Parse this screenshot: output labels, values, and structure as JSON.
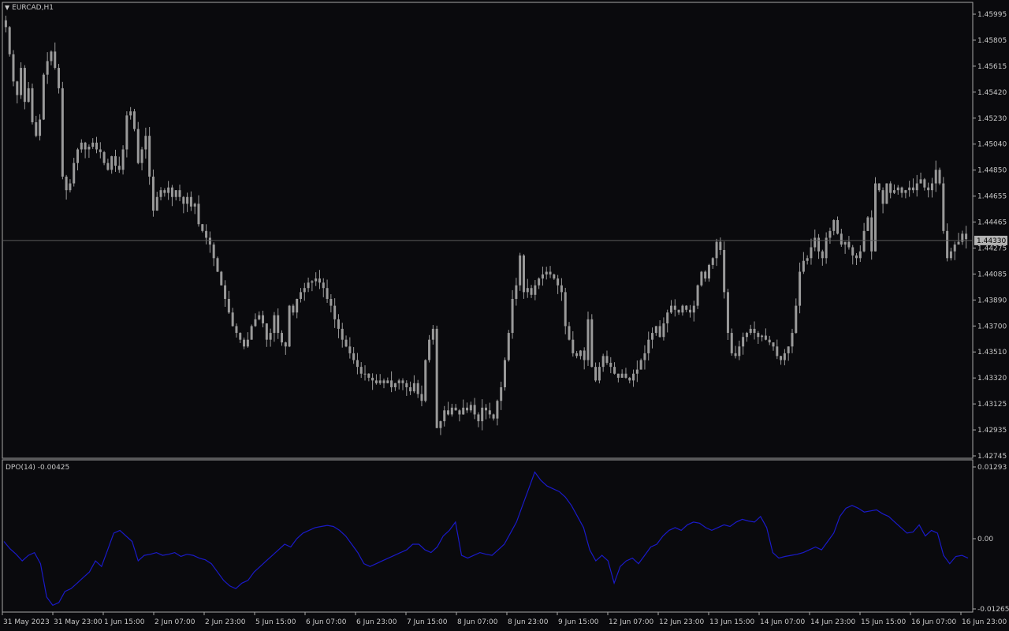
{
  "colors": {
    "background": "#0a0a0d",
    "frame": "#a8a8a8",
    "candle": "#9a9a9a",
    "current_price_line": "#5c5c5c",
    "price_tag_bg": "#b4b4b4",
    "price_tag_text": "#000000",
    "indicator_line": "#1a1ac8",
    "text": "#c8c8c8"
  },
  "header": {
    "symbol": "EURCAD,H1",
    "menu_icon": "triangle-down-icon"
  },
  "indicator": {
    "label": "DPO(14) -0.00425"
  },
  "current_price": "1.44330",
  "time_axis": [
    "31 May 2023",
    "31 May 23:00",
    "1 Jun 15:00",
    "2 Jun 07:00",
    "2 Jun 23:00",
    "5 Jun 15:00",
    "6 Jun 07:00",
    "6 Jun 23:00",
    "7 Jun 15:00",
    "8 Jun 07:00",
    "8 Jun 23:00",
    "9 Jun 15:00",
    "12 Jun 07:00",
    "12 Jun 23:00",
    "13 Jun 15:00",
    "14 Jun 07:00",
    "14 Jun 23:00",
    "15 Jun 15:00",
    "16 Jun 07:00",
    "16 Jun 23:00"
  ],
  "chart_data": [
    {
      "type": "candlestick",
      "title": "EURCAD,H1",
      "ylim": [
        1.42745,
        1.45995
      ],
      "y_ticks": [
        "1.45995",
        "1.45805",
        "1.45615",
        "1.45420",
        "1.45230",
        "1.45040",
        "1.44850",
        "1.44655",
        "1.44465",
        "1.44275",
        "1.44085",
        "1.43890",
        "1.43700",
        "1.43510",
        "1.43320",
        "1.43125",
        "1.42935",
        "1.42745"
      ],
      "close": [
        1.459,
        1.457,
        1.455,
        1.454,
        1.456,
        1.4535,
        1.4545,
        1.452,
        1.451,
        1.4522,
        1.4555,
        1.4565,
        1.4572,
        1.456,
        1.4545,
        1.448,
        1.447,
        1.4475,
        1.449,
        1.45,
        1.4505,
        1.45,
        1.4502,
        1.4505,
        1.45,
        1.4498,
        1.449,
        1.4485,
        1.4495,
        1.4488,
        1.4485,
        1.45,
        1.4525,
        1.4528,
        1.4515,
        1.449,
        1.45,
        1.451,
        1.448,
        1.4455,
        1.4465,
        1.447,
        1.4468,
        1.4472,
        1.4465,
        1.447,
        1.4465,
        1.446,
        1.4465,
        1.4458,
        1.446,
        1.4445,
        1.444,
        1.4435,
        1.443,
        1.442,
        1.441,
        1.44,
        1.439,
        1.438,
        1.437,
        1.4365,
        1.436,
        1.4355,
        1.436,
        1.437,
        1.4375,
        1.4378,
        1.4372,
        1.436,
        1.4365,
        1.4378,
        1.4365,
        1.4358,
        1.4355,
        1.4385,
        1.438,
        1.439,
        1.4395,
        1.4398,
        1.4402,
        1.4403,
        1.4405,
        1.4402,
        1.4398,
        1.439,
        1.4385,
        1.4375,
        1.4368,
        1.436,
        1.4355,
        1.435,
        1.4345,
        1.434,
        1.4335,
        1.4335,
        1.4332,
        1.433,
        1.4328,
        1.433,
        1.4328,
        1.433,
        1.4325,
        1.4328,
        1.433,
        1.4328,
        1.4325,
        1.4322,
        1.4328,
        1.432,
        1.4315,
        1.4345,
        1.436,
        1.4368,
        1.4295,
        1.43,
        1.4308,
        1.4305,
        1.431,
        1.4308,
        1.4305,
        1.431,
        1.4308,
        1.4312,
        1.4305,
        1.43,
        1.431,
        1.4308,
        1.4305,
        1.4302,
        1.4315,
        1.4325,
        1.4345,
        1.4365,
        1.439,
        1.44,
        1.4422,
        1.4395,
        1.4398,
        1.4393,
        1.44,
        1.4405,
        1.4408,
        1.441,
        1.4408,
        1.4405,
        1.44,
        1.4395,
        1.437,
        1.436,
        1.435,
        1.4348,
        1.4352,
        1.4345,
        1.4375,
        1.434,
        1.433,
        1.434,
        1.4348,
        1.4343,
        1.434,
        1.4335,
        1.4332,
        1.4335,
        1.4332,
        1.433,
        1.4335,
        1.4338,
        1.4345,
        1.435,
        1.436,
        1.4365,
        1.437,
        1.4362,
        1.4372,
        1.438,
        1.4385,
        1.4382,
        1.438,
        1.4385,
        1.4382,
        1.438,
        1.4385,
        1.44,
        1.441,
        1.4405,
        1.4415,
        1.442,
        1.4432,
        1.4426,
        1.4395,
        1.4365,
        1.435,
        1.4348,
        1.4355,
        1.4362,
        1.4365,
        1.4368,
        1.4365,
        1.4362,
        1.4363,
        1.436,
        1.4358,
        1.4355,
        1.4348,
        1.4345,
        1.435,
        1.4355,
        1.4365,
        1.4385,
        1.441,
        1.4418,
        1.442,
        1.4428,
        1.4435,
        1.4425,
        1.442,
        1.4435,
        1.444,
        1.4448,
        1.4438,
        1.443,
        1.4432,
        1.4428,
        1.4422,
        1.442,
        1.4425,
        1.444,
        1.445,
        1.4425,
        1.4475,
        1.447,
        1.446,
        1.4475,
        1.4468,
        1.447,
        1.4472,
        1.4468,
        1.447,
        1.4472,
        1.447,
        1.4475,
        1.4478,
        1.4472,
        1.447,
        1.4475,
        1.4485,
        1.4475,
        1.444,
        1.442,
        1.4425,
        1.443,
        1.4432,
        1.4438,
        1.4434
      ]
    },
    {
      "type": "line",
      "title": "DPO(14) -0.00425",
      "ylim": [
        -0.01265,
        0.01293
      ],
      "y_ticks": [
        "0.01293",
        "0.00",
        "-0.01265"
      ],
      "series": [
        {
          "values": [
            -0.0005,
            -0.0018,
            -0.0028,
            -0.004,
            -0.003,
            -0.0025,
            -0.0045,
            -0.0105,
            -0.012,
            -0.0115,
            -0.0095,
            -0.009,
            -0.008,
            -0.007,
            -0.006,
            -0.004,
            -0.005,
            -0.002,
            0.001,
            0.0015,
            0.0005,
            -0.0005,
            -0.004,
            -0.003,
            -0.0028,
            -0.0025,
            -0.003,
            -0.0028,
            -0.0025,
            -0.0032,
            -0.0028,
            -0.003,
            -0.0035,
            -0.0038,
            -0.0045,
            -0.006,
            -0.0075,
            -0.0085,
            -0.009,
            -0.008,
            -0.0075,
            -0.006,
            -0.005,
            -0.004,
            -0.003,
            -0.002,
            -0.001,
            -0.0015,
            0.0,
            0.001,
            0.0015,
            0.002,
            0.0022,
            0.0024,
            0.0022,
            0.0015,
            0.0005,
            -0.001,
            -0.0025,
            -0.0045,
            -0.005,
            -0.0045,
            -0.004,
            -0.0035,
            -0.003,
            -0.0025,
            -0.002,
            -0.001,
            -0.001,
            -0.002,
            -0.0025,
            -0.0015,
            0.0005,
            0.0015,
            0.003,
            -0.003,
            -0.0035,
            -0.003,
            -0.0025,
            -0.0028,
            -0.003,
            -0.002,
            -0.001,
            0.001,
            0.003,
            0.006,
            0.009,
            0.012,
            0.0105,
            0.0095,
            0.009,
            0.0085,
            0.0075,
            0.006,
            0.004,
            0.002,
            -0.002,
            -0.004,
            -0.003,
            -0.004,
            -0.008,
            -0.005,
            -0.004,
            -0.0035,
            -0.0045,
            -0.003,
            -0.0015,
            -0.001,
            0.0005,
            0.0015,
            0.002,
            0.0015,
            0.0025,
            0.003,
            0.0028,
            0.002,
            0.0015,
            0.002,
            0.0025,
            0.0022,
            0.003,
            0.0035,
            0.0032,
            0.003,
            0.004,
            0.002,
            -0.0025,
            -0.0035,
            -0.0032,
            -0.003,
            -0.0028,
            -0.0025,
            -0.002,
            -0.0015,
            -0.002,
            -0.0005,
            0.001,
            0.004,
            0.0055,
            0.006,
            0.0055,
            0.0048,
            0.005,
            0.0052,
            0.0045,
            0.004,
            0.003,
            0.002,
            0.001,
            0.0012,
            0.0025,
            0.0005,
            0.0015,
            0.001,
            -0.003,
            -0.0045,
            -0.0032,
            -0.003,
            -0.0035
          ]
        }
      ]
    }
  ]
}
